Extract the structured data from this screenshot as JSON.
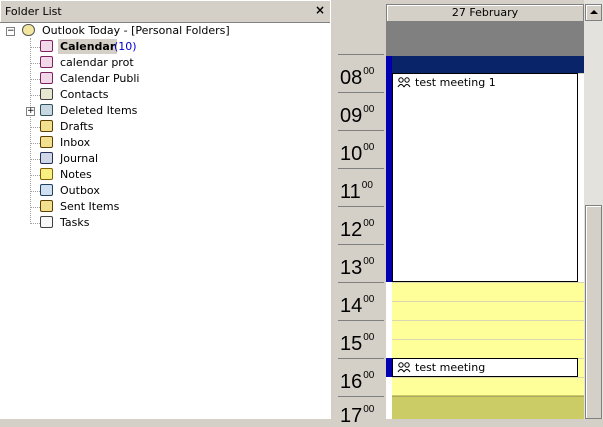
{
  "folder_list": {
    "title": "Folder List",
    "close_glyph": "×",
    "root": {
      "label": "Outlook Today - [Personal Folders]",
      "icon": "outlook-today-icon",
      "expander": "−"
    },
    "items": [
      {
        "label": "Calendar",
        "count": "(10)",
        "icon": "calendar-icon",
        "selected": true
      },
      {
        "label": "calendar prot",
        "icon": "calendar-icon"
      },
      {
        "label": "Calendar Publi",
        "icon": "calendar-icon"
      },
      {
        "label": "Contacts",
        "icon": "contacts-icon"
      },
      {
        "label": "Deleted Items",
        "icon": "deleted-items-icon",
        "expander": "+"
      },
      {
        "label": "Drafts",
        "icon": "drafts-icon"
      },
      {
        "label": "Inbox",
        "icon": "inbox-icon"
      },
      {
        "label": "Journal",
        "icon": "journal-icon"
      },
      {
        "label": "Notes",
        "icon": "notes-icon"
      },
      {
        "label": "Outbox",
        "icon": "outbox-icon"
      },
      {
        "label": "Sent Items",
        "icon": "sent-items-icon"
      },
      {
        "label": "Tasks",
        "icon": "tasks-icon"
      }
    ]
  },
  "calendar": {
    "date_header": "27 February",
    "hours": [
      {
        "hour": "08",
        "minutes": "00"
      },
      {
        "hour": "09",
        "minutes": "00"
      },
      {
        "hour": "10",
        "minutes": "00"
      },
      {
        "hour": "11",
        "minutes": "00"
      },
      {
        "hour": "12",
        "minutes": "00"
      },
      {
        "hour": "13",
        "minutes": "00"
      },
      {
        "hour": "14",
        "minutes": "00"
      },
      {
        "hour": "15",
        "minutes": "00"
      },
      {
        "hour": "16",
        "minutes": "00"
      },
      {
        "hour": "17",
        "minutes": "00"
      }
    ],
    "appointments": [
      {
        "subject": "test meeting 1",
        "start": "08:30",
        "end": "14:00",
        "icon": "meeting-icon"
      },
      {
        "subject": "test meeting",
        "start": "16:00",
        "end": "16:30",
        "icon": "meeting-icon"
      }
    ],
    "colors": {
      "working_hours": "#ffffff",
      "after_hours": "#ffff99",
      "after_hours_shaded": "#cccc66",
      "busy": "#0000b0",
      "all_day": "#808080",
      "selected_slot": "#0a246a"
    }
  }
}
